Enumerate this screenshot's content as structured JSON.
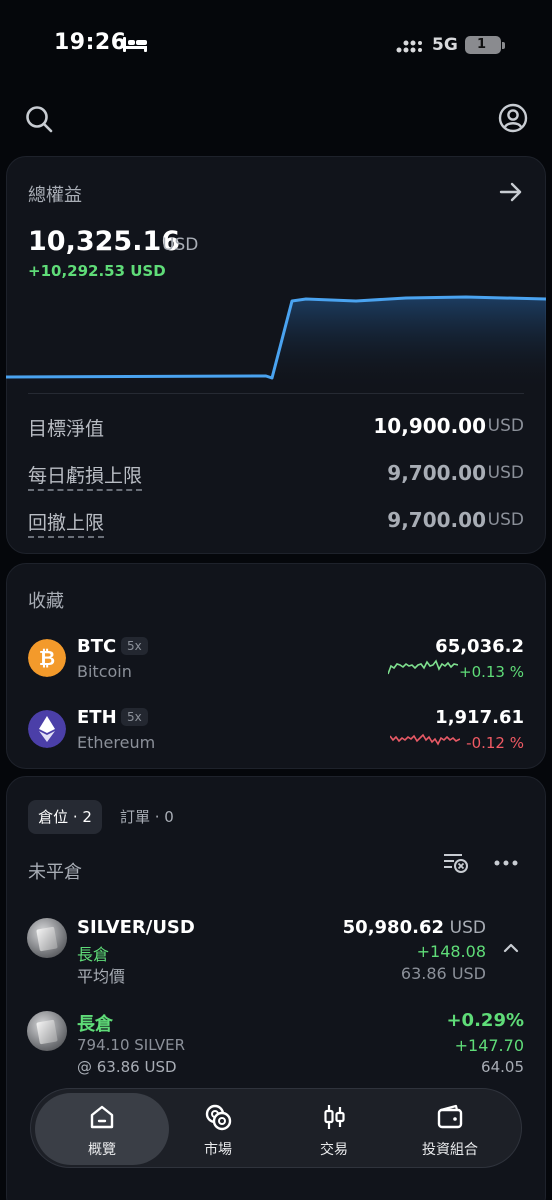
{
  "status_bar": {
    "time": "19:26",
    "network": "5G",
    "battery": "1"
  },
  "equity": {
    "title": "總權益",
    "value": "10,325.16",
    "unit": "USD",
    "change": "+10,292.53 USD",
    "rows": [
      {
        "label": "目標淨值",
        "value": "10,900.00",
        "unit": "USD"
      },
      {
        "label": "每日虧損上限",
        "value": "9,700.00",
        "unit": "USD"
      },
      {
        "label": "回撤上限",
        "value": "9,700.00",
        "unit": "USD"
      }
    ]
  },
  "favorites": {
    "title": "收藏",
    "items": [
      {
        "symbol": "BTC",
        "leverage": "5x",
        "name": "Bitcoin",
        "price": "65,036.2",
        "change": "+0.13 %"
      },
      {
        "symbol": "ETH",
        "leverage": "5x",
        "name": "Ethereum",
        "price": "1,917.61",
        "change": "-0.12 %"
      }
    ]
  },
  "positions": {
    "tabs": [
      "倉位 · 2",
      "訂單 · 0"
    ],
    "section_label": "未平倉",
    "summary": {
      "symbol": "SILVER/USD",
      "side": "長倉",
      "avg_label": "平均價",
      "value": "50,980.62",
      "unit": "USD",
      "pnl": "+148.08",
      "avg_price": "63.86 USD"
    },
    "detail": {
      "side": "長倉",
      "qty": "794.10 SILVER",
      "entry": "@ 63.86 USD",
      "pct": "+0.29%",
      "pnl": "+147.70",
      "mark": "64.05"
    }
  },
  "nav": {
    "items": [
      "概覽",
      "市場",
      "交易",
      "投資組合"
    ],
    "active": 0
  },
  "colors": {
    "accent": "#4aa3f0",
    "gain": "#5fdc78",
    "loss": "#f05a64",
    "background": "#05070b",
    "card": "#11141b"
  }
}
